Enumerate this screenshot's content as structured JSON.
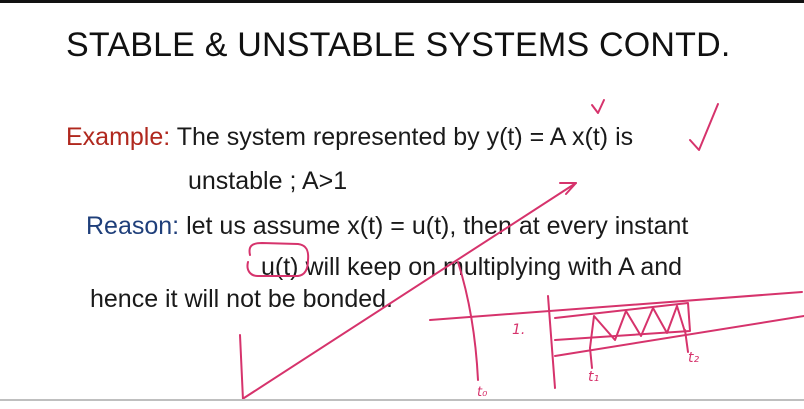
{
  "slide": {
    "title": "STABLE & UNSTABLE SYSTEMS CONTD.",
    "example_label": "Example:",
    "example_text": "The system represented by  y(t) = A x(t) is",
    "example_text2": "unstable ; A>1",
    "reason_label": "Reason:",
    "reason_text": "let us assume x(t) = u(t), then at  every instant",
    "reason_text2": "u(t) will keep on multiplying with A and",
    "reason_text3": "hence it will not be bonded."
  },
  "annotations": {
    "t0": "t₀",
    "t1": "t₁",
    "t2": "t₂",
    "one": "1."
  },
  "colors": {
    "ink": "#d6336c",
    "example": "#b0281e",
    "reason": "#1f3f7a"
  }
}
